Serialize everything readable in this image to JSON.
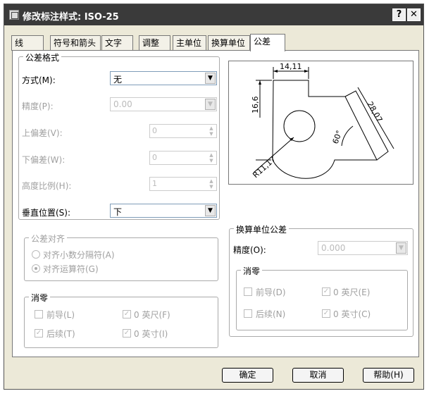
{
  "window": {
    "title": "修改标注样式: ISO-25",
    "help_glyph": "?",
    "close_glyph": "✕"
  },
  "tabs": [
    "线",
    "符号和箭头",
    "文字",
    "调整",
    "主单位",
    "换算单位",
    "公差"
  ],
  "tolerance_format": {
    "legend": "公差格式",
    "method_label": "方式(M):",
    "method_value": "无",
    "precision_label": "精度(P):",
    "precision_value": "0.00",
    "upper_label": "上偏差(V):",
    "upper_value": "0",
    "lower_label": "下偏差(W):",
    "lower_value": "0",
    "height_label": "高度比例(H):",
    "height_value": "1",
    "vertical_label": "垂直位置(S):",
    "vertical_value": "下"
  },
  "tolerance_alignment": {
    "legend": "公差对齐",
    "option1": "对齐小数分隔符(A)",
    "option2": "对齐运算符(G)",
    "selected": 2
  },
  "zero_suppression": {
    "legend": "消零",
    "leading": "前导(L)",
    "leading_checked": false,
    "trailing": "后续(T)",
    "trailing_checked": true,
    "feet": "0 英尺(F)",
    "feet_checked": true,
    "inches": "0 英寸(I)",
    "inches_checked": true
  },
  "preview": {
    "dim_top": "14,11",
    "dim_left": "16,6",
    "dim_right": "28,07",
    "angle": "60°",
    "radius": "R11,17"
  },
  "alt_tolerance": {
    "legend": "换算单位公差",
    "precision_label": "精度(O):",
    "precision_value": "0.000",
    "zero_legend": "消零",
    "leading": "前导(D)",
    "leading_checked": false,
    "trailing": "后续(N)",
    "trailing_checked": false,
    "feet": "0 英尺(E)",
    "feet_checked": true,
    "inches": "0 英寸(C)",
    "inches_checked": true
  },
  "buttons": {
    "ok": "确定",
    "cancel": "取消",
    "help": "帮助(H)"
  },
  "glyphs": {
    "check": "✓",
    "dropdown": "▼",
    "spin_up": "▲",
    "spin_down": "▼"
  }
}
